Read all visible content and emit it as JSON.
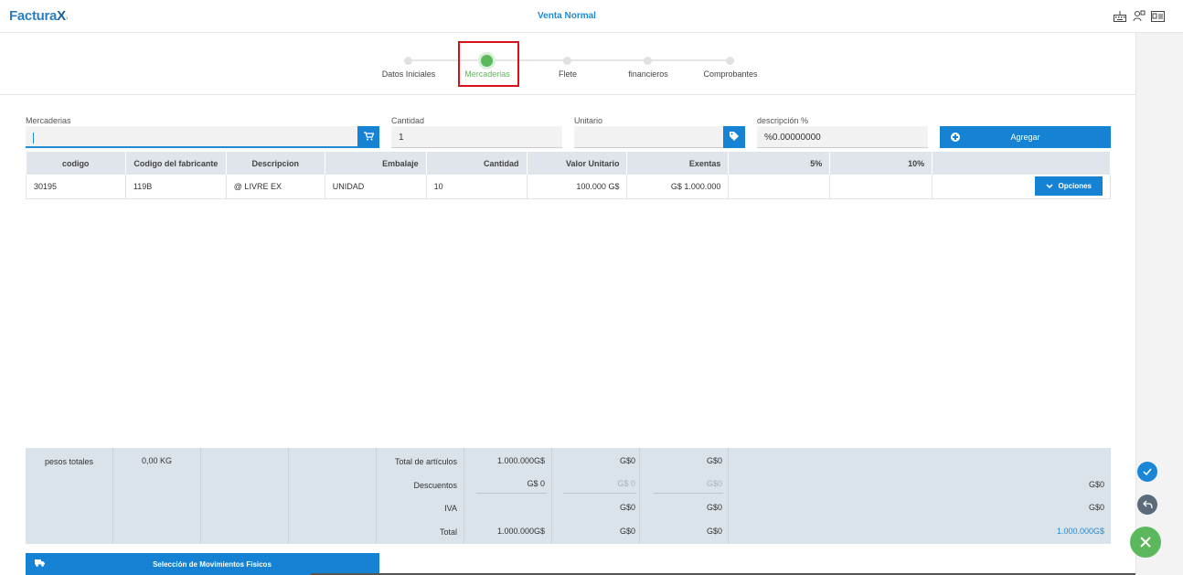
{
  "header": {
    "logo_text": "Factura",
    "logo_x": "X",
    "title": "Venta Normal",
    "icons": [
      "keyboard-icon",
      "users-icon",
      "id-card-icon"
    ]
  },
  "stepper": {
    "steps": [
      {
        "label": "Datos Iniciales",
        "active": false
      },
      {
        "label": "Mercaderias",
        "active": true
      },
      {
        "label": "Flete",
        "active": false
      },
      {
        "label": "financieros",
        "active": false
      },
      {
        "label": "Comprobantes",
        "active": false
      }
    ]
  },
  "form": {
    "mercaderias_label": "Mercaderias",
    "mercaderias_value": "",
    "cantidad_label": "Cantidad",
    "cantidad_value": "1",
    "unitario_label": "Unitario",
    "unitario_value": "",
    "descripcion_label": "descripción %",
    "descripcion_value": "%0.00000000",
    "agregar_label": "Agregar"
  },
  "table": {
    "headers": [
      "codigo",
      "Codigo del fabricante",
      "Descripcion",
      "Embalaje",
      "Cantidad",
      "Valor Unitario",
      "Exentas",
      "5%",
      "10%",
      ""
    ],
    "rows": [
      {
        "codigo": "30195",
        "fabricante": "119B",
        "descripcion": "@ LIVRE EX",
        "embalaje": "UNIDAD",
        "cantidad": "10",
        "valor_unitario": "100.000 G$",
        "exentas": "G$ 1.000.000",
        "iva5": "",
        "iva10": "",
        "opciones": "Opciones"
      }
    ]
  },
  "totals": {
    "pesos_label": "pesos totales",
    "pesos_value": "0,00 KG",
    "total_articulos_label": "Total de artículos",
    "descuentos_label": "Descuentos",
    "iva_label": "IVA",
    "total_label": "Total",
    "articulos": [
      "1.000.000G$",
      "G$0",
      "G$0"
    ],
    "descuentos": [
      "G$ 0",
      "G$ 0",
      "G$0"
    ],
    "iva": [
      "",
      "G$0",
      "G$0"
    ],
    "total": [
      "1.000.000G$",
      "G$0",
      "G$0"
    ],
    "right_descuentos": "G$0",
    "right_iva": "G$0",
    "right_total": "1.000.000G$"
  },
  "actions": {
    "movimientos_label": "Selección de Movimientos Fisicos"
  },
  "colors": {
    "primary": "#1582d3",
    "success": "#5cb85c",
    "highlight": "#d6111b"
  }
}
